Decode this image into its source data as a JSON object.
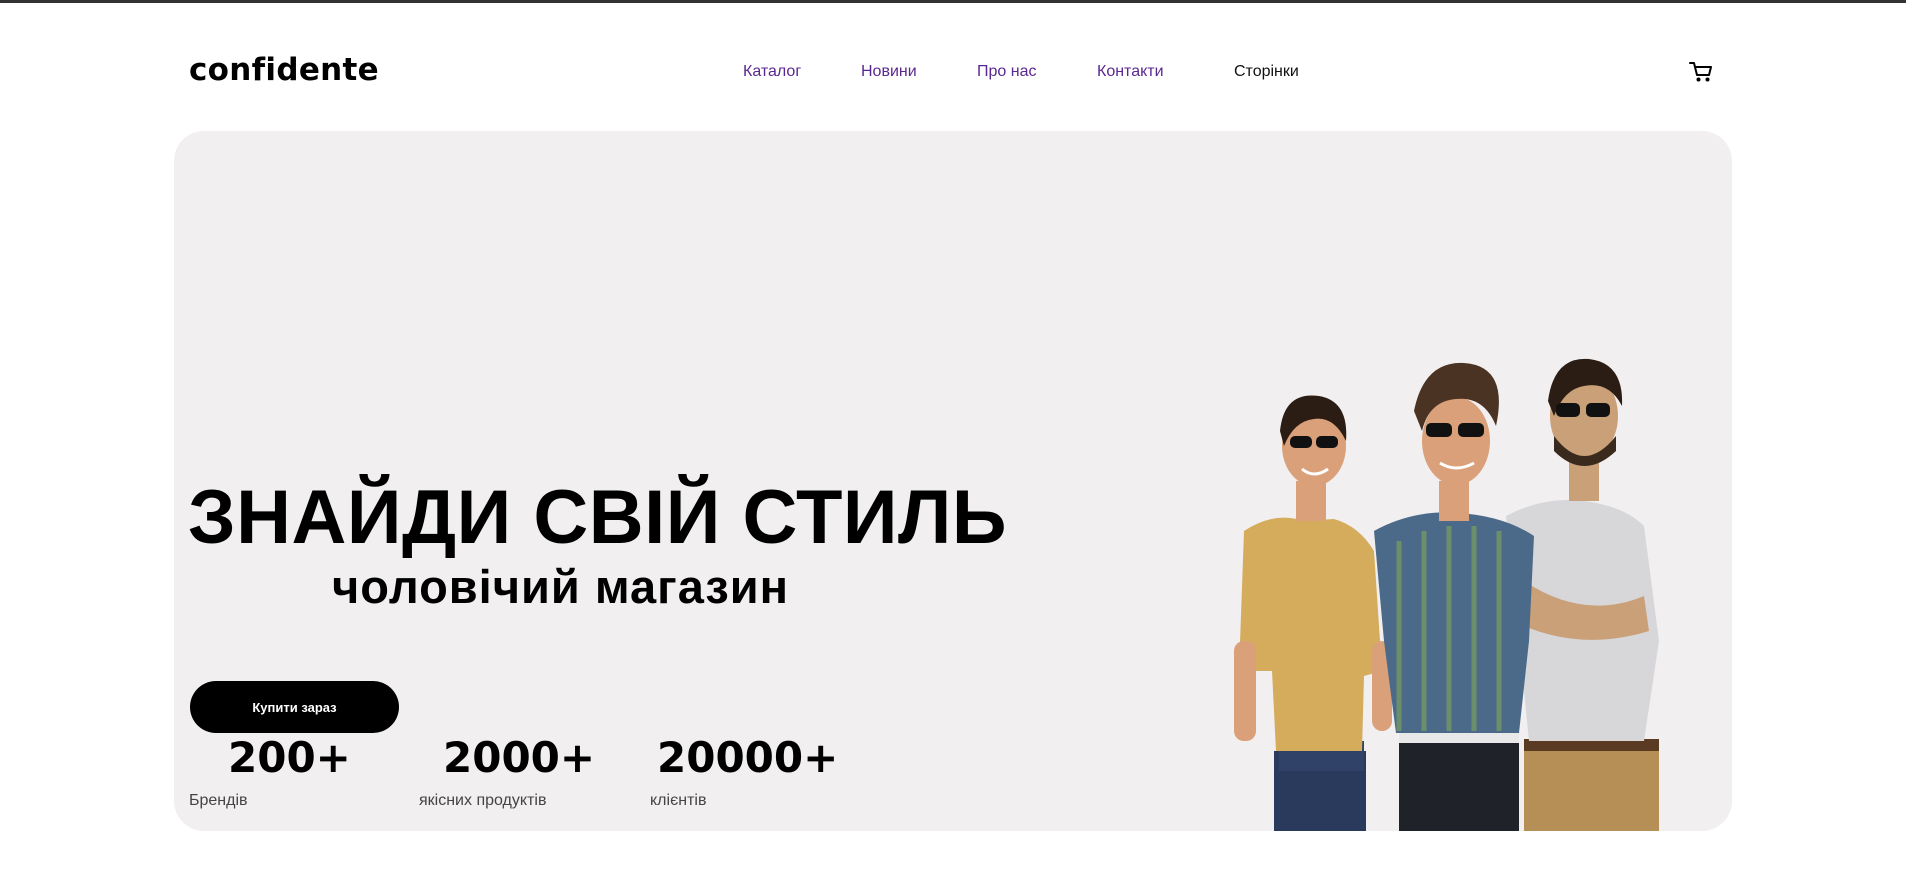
{
  "header": {
    "logo": "confidente",
    "nav": [
      {
        "label": "Каталог"
      },
      {
        "label": "Новини"
      },
      {
        "label": "Про нас"
      },
      {
        "label": "Контакти"
      },
      {
        "label": "Сторінки"
      }
    ],
    "cart_icon": "cart-icon"
  },
  "hero": {
    "title": "ЗНАЙДИ СВІЙ СТИЛЬ",
    "subtitle": "чоловічий магазин",
    "cta_label": "Купити зараз",
    "stats": [
      {
        "value": "200+",
        "label": "Брендів"
      },
      {
        "value": "2000+",
        "label": "якісних продуктів"
      },
      {
        "value": "20000+",
        "label": "клієнтів"
      }
    ],
    "image_icon": "group-of-men-photo"
  },
  "colors": {
    "nav_link": "#5b2790",
    "hero_bg": "#f1eff0",
    "button_bg": "#000000"
  }
}
